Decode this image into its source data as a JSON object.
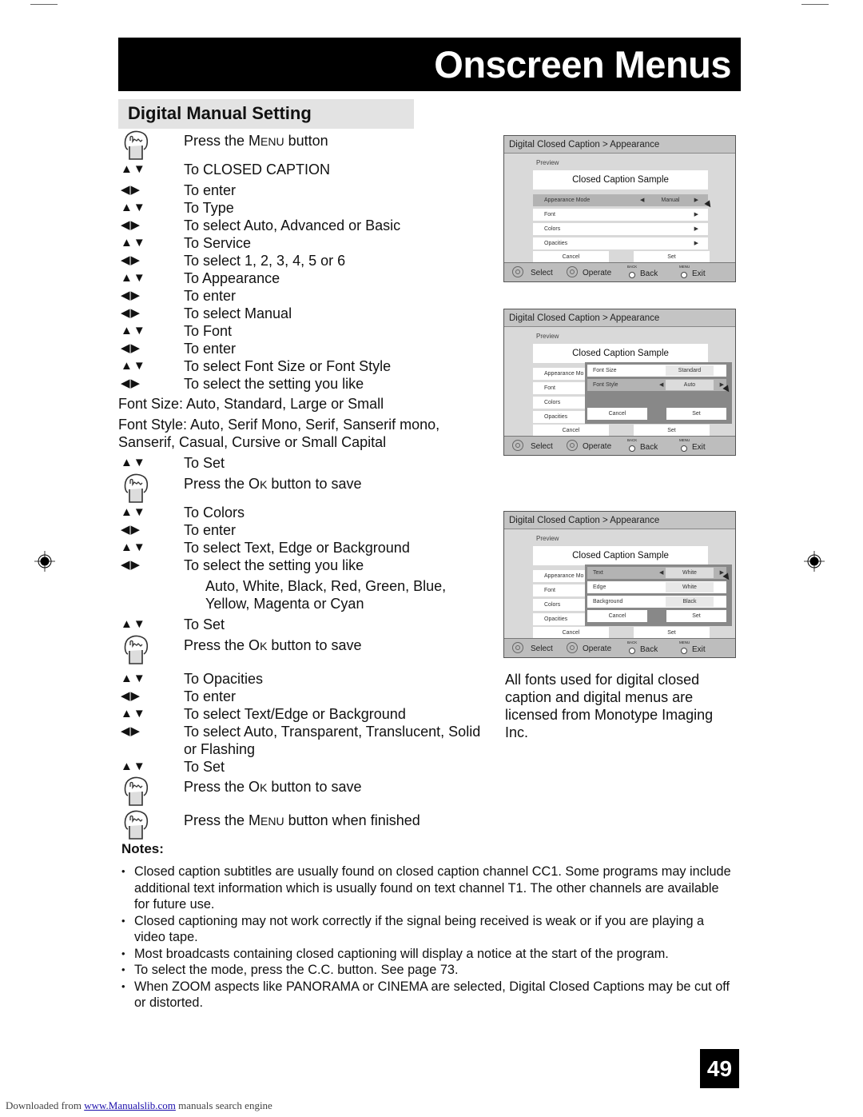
{
  "banner": {
    "title": "Onscreen Menus"
  },
  "section": {
    "title": "Digital Manual Setting"
  },
  "steps": [
    {
      "icon": "hand",
      "text_pre": "Press the ",
      "text_sc": "Menu",
      "text_post": " button"
    },
    {
      "icon": "updown",
      "text": "To CLOSED CAPTION"
    },
    {
      "icon": "leftright",
      "text": "To enter"
    },
    {
      "icon": "updown",
      "text": "To Type"
    },
    {
      "icon": "leftright",
      "text": "To select Auto, Advanced or Basic"
    },
    {
      "icon": "updown",
      "text": "To Service"
    },
    {
      "icon": "leftright",
      "text": "To select 1, 2, 3, 4, 5 or 6"
    },
    {
      "icon": "updown",
      "text": "To Appearance"
    },
    {
      "icon": "leftright",
      "text": "To enter"
    },
    {
      "icon": "leftright",
      "text": "To select Manual"
    },
    {
      "icon": "updown",
      "text": "To Font"
    },
    {
      "icon": "leftright",
      "text": "To enter"
    },
    {
      "icon": "updown",
      "text": "To select Font Size or Font Style"
    },
    {
      "icon": "leftright",
      "text": "To select the setting you like"
    }
  ],
  "font_size_note": "Font Size: Auto, Standard, Large or Small",
  "font_style_note": [
    "Font Style: Auto, Serif Mono, Serif, Sanserif mono,",
    "Sanserif, Casual, Cursive or Small Capital"
  ],
  "steps2": [
    {
      "icon": "updown",
      "text": "To Set"
    },
    {
      "icon": "hand",
      "text_pre": "Press the ",
      "text_sc": "Ok",
      "text_post": " button to save"
    },
    {
      "icon": "updown",
      "text": "To Colors"
    },
    {
      "icon": "leftright",
      "text": "To enter"
    },
    {
      "icon": "updown",
      "text": "To select Text, Edge or Background"
    },
    {
      "icon": "leftright",
      "text": "To select the setting you like"
    }
  ],
  "colors_note": [
    "Auto, White, Black, Red, Green, Blue,",
    "Yellow, Magenta or Cyan"
  ],
  "steps3": [
    {
      "icon": "updown",
      "text": "To Set"
    },
    {
      "icon": "hand",
      "text_pre": "Press the ",
      "text_sc": "Ok",
      "text_post": " button to save"
    },
    {
      "icon": "updown",
      "text": "To Opacities"
    },
    {
      "icon": "leftright",
      "text": "To enter"
    },
    {
      "icon": "updown",
      "text": "To select Text/Edge or Background"
    },
    {
      "icon": "leftright",
      "text": "To select Auto, Transparent, Translucent, Solid"
    },
    {
      "text": "or Flashing"
    },
    {
      "icon": "updown",
      "text": "To Set"
    },
    {
      "icon": "hand",
      "text_pre": "Press the ",
      "text_sc": "Ok",
      "text_post": " button to save"
    },
    {
      "icon": "hand",
      "text_pre": "Press the ",
      "text_sc": "Menu",
      "text_post": " button when finished"
    }
  ],
  "icons": {
    "updown": "▲▼",
    "leftright": "◀▶"
  },
  "screens": [
    {
      "header": "Digital Closed Caption  >  Appearance",
      "preview_label": "Preview",
      "sample": "Closed Caption Sample",
      "rows": [
        {
          "label": "Appearance Mode",
          "value": "Manual",
          "selected": true
        },
        {
          "label": "Font",
          "value": ""
        },
        {
          "label": "Colors",
          "value": ""
        },
        {
          "label": "Opacities",
          "value": ""
        }
      ],
      "cancel": "Cancel",
      "set": "Set",
      "footer": {
        "select": "Select",
        "operate": "Operate",
        "back_small": "BACK",
        "back": "Back",
        "menu_small": "MENU",
        "exit": "Exit"
      }
    },
    {
      "header": "Digital Closed Caption  >  Appearance",
      "preview_label": "Preview",
      "sample": "Closed Caption Sample",
      "rows": [
        {
          "label": "Appearance Mo"
        },
        {
          "label": "Font"
        },
        {
          "label": "Colors"
        },
        {
          "label": "Opacities"
        }
      ],
      "popup": [
        {
          "label": "Font Size",
          "value": "Standard"
        },
        {
          "label": "Font Style",
          "value": "Auto",
          "selected": true
        }
      ],
      "popup_cancel": "Cancel",
      "popup_set": "Set",
      "cancel": "Cancel",
      "set": "Set",
      "footer": {
        "select": "Select",
        "operate": "Operate",
        "back_small": "BACK",
        "back": "Back",
        "menu_small": "MENU",
        "exit": "Exit"
      }
    },
    {
      "header": "Digital Closed Caption  >  Appearance",
      "preview_label": "Preview",
      "sample": "Closed Caption Sample",
      "rows": [
        {
          "label": "Appearance Mo"
        },
        {
          "label": "Font"
        },
        {
          "label": "Colors"
        },
        {
          "label": "Opacities"
        }
      ],
      "popup": [
        {
          "label": "Text",
          "value": "White",
          "selected": true
        },
        {
          "label": "Edge",
          "value": "White"
        },
        {
          "label": "Background",
          "value": "Black"
        }
      ],
      "popup_cancel": "Cancel",
      "popup_set": "Set",
      "cancel": "Cancel",
      "set": "Set",
      "footer": {
        "select": "Select",
        "operate": "Operate",
        "back_small": "BACK",
        "back": "Back",
        "menu_small": "MENU",
        "exit": "Exit"
      }
    }
  ],
  "side_note": "All fonts used for digital closed caption and digital menus are licensed from Monotype Imaging Inc.",
  "notes": {
    "heading": "Notes:",
    "items": [
      "Closed caption subtitles are usually found on closed caption channel CC1. Some programs may include additional text information which is usually found on text channel T1. The other channels are available for future use.",
      "Closed captioning may not work correctly if the signal being received is weak or if you are playing a video tape.",
      "Most broadcasts containing closed captioning will display a notice at the start of the program.",
      "To select the mode, press the C.C. button. See page 73.",
      "When ZOOM aspects like PANORAMA or CINEMA are selected, Digital Closed Captions may be cut off or distorted."
    ]
  },
  "page_number": "49",
  "download": {
    "prefix": "Downloaded from ",
    "link": "www.Manualslib.com",
    "suffix": " manuals search engine"
  }
}
